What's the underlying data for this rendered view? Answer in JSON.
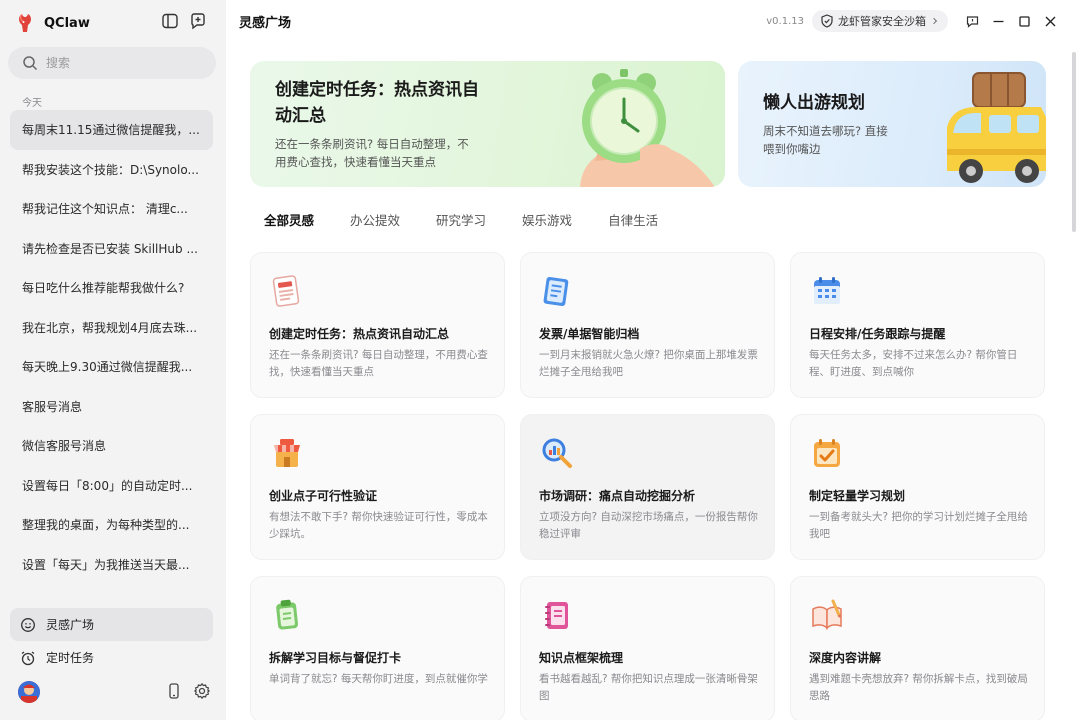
{
  "app": {
    "name": "QClaw"
  },
  "sidebar": {
    "search_placeholder": "搜索",
    "section_today": "今天",
    "conversations": [
      "每周末11.15通过微信提醒我，...",
      "帮我安装这个技能：D:\\Synolo...",
      "帮我记住这个知识点： 清理c...",
      "请先检查是否已安装 SkillHub ...",
      "每日吃什么推荐能帮我做什么?",
      "我在北京，帮我规划4月底去珠...",
      "每天晚上9.30通过微信提醒我...",
      "客服号消息",
      "微信客服号消息",
      "设置每日「8:00」的自动定时...",
      "整理我的桌面，为每种类型的...",
      "设置「每天」为我推送当天最..."
    ],
    "nav": [
      {
        "label": "灵感广场",
        "icon": "smile-icon"
      },
      {
        "label": "定时任务",
        "icon": "alarm-clock-icon"
      }
    ]
  },
  "header": {
    "title": "灵感广场",
    "version": "v0.1.13",
    "sandbox_label": "龙虾管家安全沙箱"
  },
  "banners": [
    {
      "title_line1": "创建定时任务：热点资讯自",
      "title_line2": "动汇总",
      "desc_line1": "还在一条条刷资讯? 每日自动整理，不",
      "desc_line2": "用费心查找，快速看懂当天重点"
    },
    {
      "title": "懒人出游规划",
      "desc_line1": "周末不知道去哪玩? 直接",
      "desc_line2": "喂到你嘴边"
    }
  ],
  "tabs": [
    "全部灵感",
    "办公提效",
    "研究学习",
    "娱乐游戏",
    "自律生活"
  ],
  "cards": [
    {
      "title": "创建定时任务：热点资讯自动汇总",
      "desc": "还在一条条刷资讯? 每日自动整理，不用费心查找，快速看懂当天重点",
      "icon": "newspaper-icon"
    },
    {
      "title": "发票/单据智能归档",
      "desc": "一到月末报销就火急火燎? 把你桌面上那堆发票烂摊子全甩给我吧",
      "icon": "document-icon"
    },
    {
      "title": "日程安排/任务跟踪与提醒",
      "desc": "每天任务太多，安排不过来怎么办? 帮你管日程、盯进度、到点喊你",
      "icon": "calendar-icon"
    },
    {
      "title": "创业点子可行性验证",
      "desc": "有想法不敢下手? 帮你快速验证可行性，零成本少踩坑。",
      "icon": "store-icon"
    },
    {
      "title": "市场调研：痛点自动挖掘分析",
      "desc": "立项没方向? 自动深挖市场痛点，一份报告帮你稳过评审",
      "icon": "magnifier-chart-icon"
    },
    {
      "title": "制定轻量学习规划",
      "desc": "一到备考就头大? 把你的学习计划烂摊子全甩给我吧",
      "icon": "checklist-calendar-icon"
    },
    {
      "title": "拆解学习目标与督促打卡",
      "desc": "单词背了就忘? 每天帮你盯进度，到点就催你学",
      "icon": "clipboard-icon"
    },
    {
      "title": "知识点框架梳理",
      "desc": "看书越看越乱? 帮你把知识点理成一张清晰骨架图",
      "icon": "notebook-icon"
    },
    {
      "title": "深度内容讲解",
      "desc": "遇到难题卡壳想放弃? 帮你拆解卡点，找到破局思路",
      "icon": "open-book-icon"
    }
  ],
  "colors": {
    "sidebar_bg": "#f3f3f4",
    "banner_green": "#e3f6dc",
    "banner_blue": "#dcecfb"
  }
}
